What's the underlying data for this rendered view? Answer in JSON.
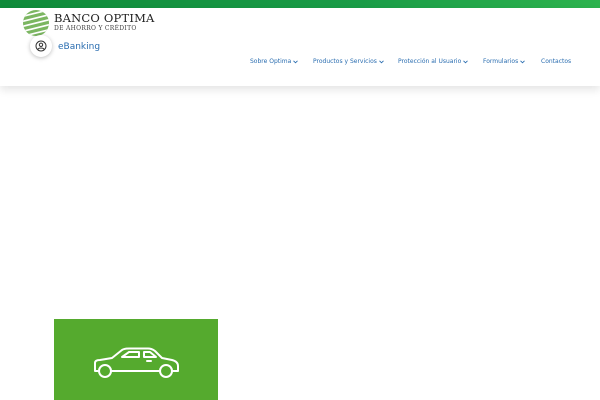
{
  "brand": {
    "name": "BANCO OPTIMA",
    "subtitle": "DE AHORRO Y CRÉDITO",
    "logo_icon": "globe-stripes-logo-icon"
  },
  "ebanking": {
    "label": "eBanking",
    "icon": "user-circle-icon"
  },
  "nav": {
    "items": [
      {
        "label": "Sobre Optima",
        "has_dropdown": true
      },
      {
        "label": "Productos y Servicios",
        "has_dropdown": true
      },
      {
        "label": "Protección al Usuario",
        "has_dropdown": true
      },
      {
        "label": "Formularios",
        "has_dropdown": true
      },
      {
        "label": "Contactos",
        "has_dropdown": false
      }
    ]
  },
  "card": {
    "icon": "car-icon"
  },
  "colors": {
    "top_bar": "#1a9c47",
    "nav_link": "#2a6db0",
    "card_bg": "#55aa2e"
  }
}
